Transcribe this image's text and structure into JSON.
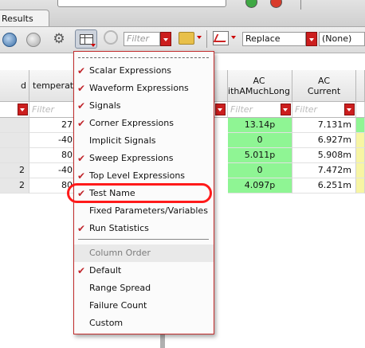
{
  "window": {
    "tab_label": "Results"
  },
  "toolbar": {
    "filter_placeholder": "Filter",
    "replace_value": "Replace",
    "none_value": "(None)"
  },
  "table": {
    "headers": [
      {
        "label": "d"
      },
      {
        "label": "temperature"
      },
      {
        "label": "AC\nithAMuchLong"
      },
      {
        "label": "AC\nCurrent"
      }
    ],
    "filter_placeholder": "Filter",
    "rows": [
      {
        "left": "",
        "temperature": "27",
        "ac_long": "13.14p",
        "ac_current": "7.131m"
      },
      {
        "left": "",
        "temperature": "-40",
        "ac_long": "0",
        "ac_current": "6.927m"
      },
      {
        "left": "",
        "temperature": "80",
        "ac_long": "5.011p",
        "ac_current": "5.908m"
      },
      {
        "left": "2",
        "temperature": "-40",
        "ac_long": "0",
        "ac_current": "7.472m"
      },
      {
        "left": "2",
        "temperature": "80",
        "ac_long": "4.097p",
        "ac_current": "6.251m"
      }
    ]
  },
  "menu": {
    "items": [
      {
        "label": "Scalar Expressions",
        "checked": true
      },
      {
        "label": "Waveform Expressions",
        "checked": true
      },
      {
        "label": "Signals",
        "checked": true
      },
      {
        "label": "Corner Expressions",
        "checked": true
      },
      {
        "label": "Implicit Signals",
        "checked": false
      },
      {
        "label": "Sweep Expressions",
        "checked": true
      },
      {
        "label": "Top Level Expressions",
        "checked": true
      },
      {
        "label": "Test Name",
        "checked": true
      },
      {
        "label": "Fixed Parameters/Variables",
        "checked": false
      },
      {
        "label": "Run Statistics",
        "checked": true
      }
    ],
    "column_order_header": "Column Order",
    "column_order_items": [
      {
        "label": "Default",
        "checked": true
      },
      {
        "label": "Range Spread",
        "checked": false
      },
      {
        "label": "Failure Count",
        "checked": false
      },
      {
        "label": "Custom",
        "checked": false
      }
    ]
  },
  "colors": {
    "pass_green": "#8ff594",
    "check_red": "#c1272d",
    "highlight_ring": "#ff1a1a"
  }
}
